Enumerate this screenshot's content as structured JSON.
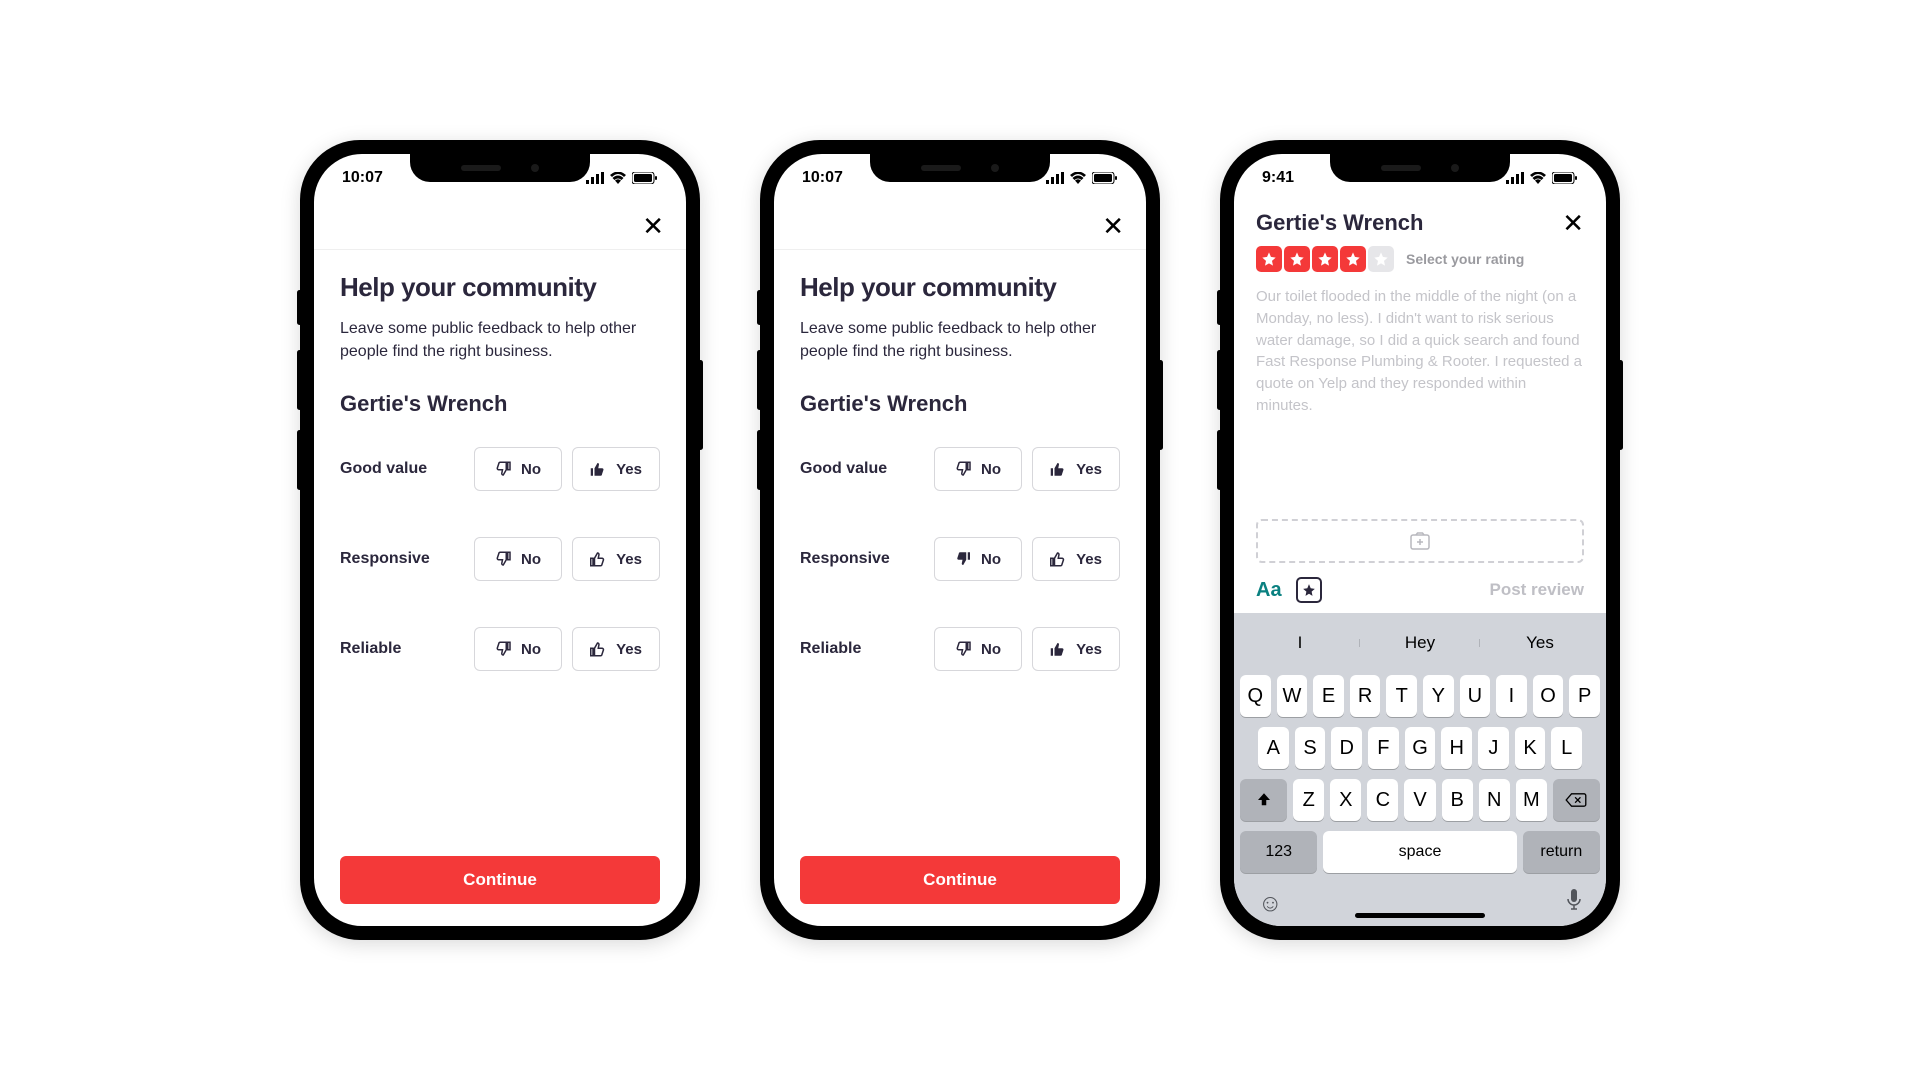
{
  "status": {
    "time_a": "10:07",
    "time_b": "10:07",
    "time_c": "9:41"
  },
  "survey": {
    "title": "Help your community",
    "subtitle": "Leave some public feedback to help other people find the right business.",
    "business": "Gertie's Wrench",
    "no": "No",
    "yes": "Yes",
    "q1": "Good value",
    "q2": "Responsive",
    "q3": "Reliable",
    "continue": "Continue"
  },
  "phoneA": {
    "q1_sel": "yes",
    "q2_sel": null,
    "q3_sel": null
  },
  "phoneB": {
    "q1_sel": "yes",
    "q2_sel": "no",
    "q3_sel": "yes"
  },
  "review": {
    "business": "Gertie's Wrench",
    "rating_filled": 4,
    "rating_text": "Select your rating",
    "placeholder": "Our toilet flooded in the middle of the night (on a Monday, no less). I didn't want to risk serious water damage, so I did a quick search and found Fast Response Plumbing & Rooter. I requested a quote on Yelp and they responded within minutes.",
    "aa": "Aa",
    "post": "Post review"
  },
  "keyboard": {
    "suggestions": [
      "I",
      "Hey",
      "Yes"
    ],
    "row1": [
      "Q",
      "W",
      "E",
      "R",
      "T",
      "Y",
      "U",
      "I",
      "O",
      "P"
    ],
    "row2": [
      "A",
      "S",
      "D",
      "F",
      "G",
      "H",
      "J",
      "K",
      "L"
    ],
    "row3": [
      "Z",
      "X",
      "C",
      "V",
      "B",
      "N",
      "M"
    ],
    "num": "123",
    "space": "space",
    "return": "return"
  }
}
